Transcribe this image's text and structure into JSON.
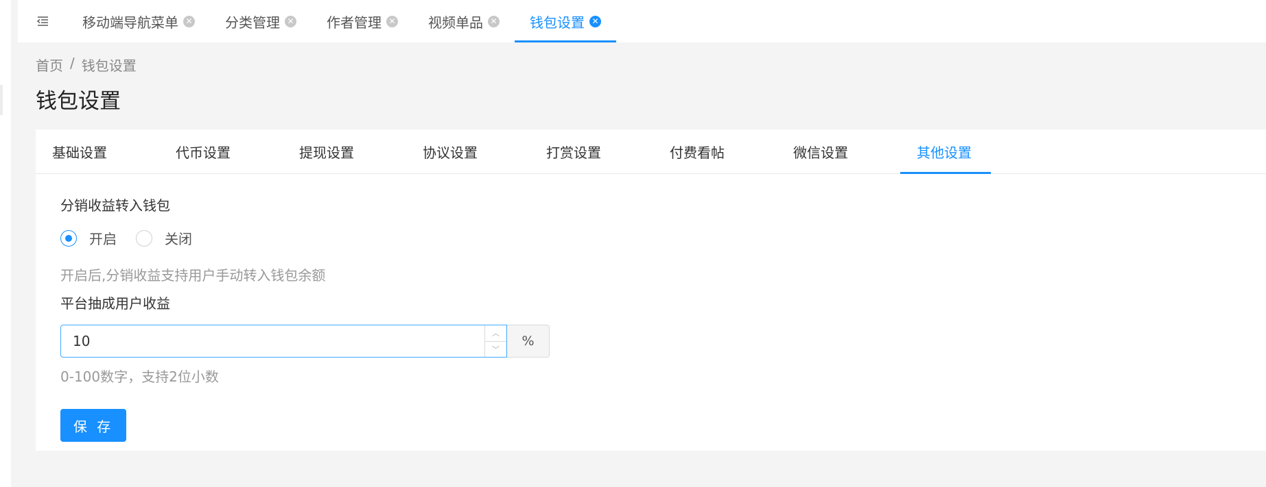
{
  "tabs": [
    {
      "label": "移动端导航菜单",
      "active": false
    },
    {
      "label": "分类管理",
      "active": false
    },
    {
      "label": "作者管理",
      "active": false
    },
    {
      "label": "视频单品",
      "active": false
    },
    {
      "label": "钱包设置",
      "active": true
    }
  ],
  "breadcrumb": {
    "home": "首页",
    "separator": "/",
    "current": "钱包设置"
  },
  "page_title": "钱包设置",
  "subtabs": [
    "基础设置",
    "代币设置",
    "提现设置",
    "协议设置",
    "打赏设置",
    "付费看帖",
    "微信设置",
    "其他设置"
  ],
  "active_subtab": "其他设置",
  "form": {
    "distribution_label": "分销收益转入钱包",
    "radio_on": "开启",
    "radio_off": "关闭",
    "distribution_help": "开启后,分销收益支持用户手动转入钱包余额",
    "commission_label": "平台抽成用户收益",
    "commission_value": "10",
    "commission_unit": "%",
    "commission_help": "0-100数字，支持2位小数",
    "save_label": "保 存"
  },
  "colors": {
    "accent": "#1890ff",
    "background": "#f4f4f4"
  },
  "icons": {
    "menu": "menu-fold-icon",
    "close": "close-circle-icon"
  }
}
